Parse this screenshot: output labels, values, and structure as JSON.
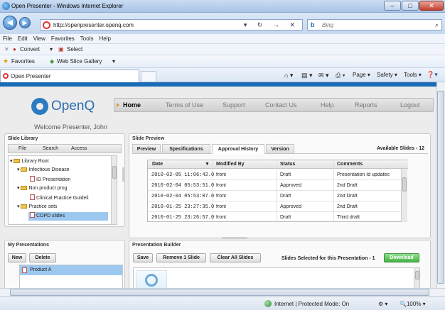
{
  "window": {
    "title": "Open Presenter - Windows Internet Explorer",
    "minimize": "–",
    "maximize": "□",
    "close": "✕"
  },
  "browser": {
    "back": "◀",
    "forward": "▶",
    "url": "http://openpresenter.openq.com",
    "search_placeholder": "Bing",
    "bing_glyph": "b",
    "search_glyph": "⌕",
    "addr_tools": "▾ ↻ → ✕",
    "menu": [
      "File",
      "Edit",
      "View",
      "Favorites",
      "Tools",
      "Help"
    ],
    "convert": "Convert",
    "select": "Select",
    "favorites": "Favorites",
    "web_slice": "Web Slice Gallery",
    "tab_title": "Open Presenter",
    "cmd_page": "Page",
    "cmd_safety": "Safety",
    "cmd_tools": "Tools",
    "status_text": "Internet | Protected Mode: On",
    "zoom": "100%"
  },
  "app": {
    "logo": "OpenQ",
    "nav": [
      "Home",
      "Terms of Use",
      "Support",
      "Contact Us",
      "Help",
      "Reports",
      "Logout"
    ],
    "welcome": "Welcome Presenter, John"
  },
  "library": {
    "title": "Slide Library",
    "tabs": [
      "File",
      "Search",
      "Access"
    ],
    "tree": [
      {
        "label": "Library Root",
        "type": "folder"
      },
      {
        "label": "Infectious Disease",
        "type": "folder"
      },
      {
        "label": "ID Presentation",
        "type": "file"
      },
      {
        "label": "Non product prog",
        "type": "folder"
      },
      {
        "label": "Clinical Practice Guideli",
        "type": "file"
      },
      {
        "label": "Practice sets",
        "type": "folder"
      },
      {
        "label": "COPD slides",
        "type": "file"
      }
    ]
  },
  "preview": {
    "title": "Slide Preview",
    "tabs": [
      "Preview",
      "Specifications",
      "Approval History",
      "Version"
    ],
    "available": "Available Slides - 12",
    "columns": [
      "Date",
      "Modified By",
      "Status",
      "Comments"
    ],
    "sort_glyph": "▼",
    "rows": [
      [
        "2010-02-05 11:06:42.0",
        "front",
        "Draft",
        "Presentation Id updatec"
      ],
      [
        "2010-02-04 05:53:51.0",
        "front",
        "Approved",
        "2nd Draft"
      ],
      [
        "2010-02-04 05:53:07.0",
        "front",
        "Draft",
        "2nd Draft"
      ],
      [
        "2010-01-25 23:27:35.0",
        "front",
        "Approved",
        "2nd Draft"
      ],
      [
        "2010-01-25 23:26:57.0",
        "front",
        "Draft",
        "Third draft"
      ]
    ]
  },
  "my_presentations": {
    "title": "My Presentations",
    "new": "New",
    "delete": "Delete",
    "items": [
      "Product A"
    ]
  },
  "builder": {
    "title": "Presentation Builder",
    "save": "Save",
    "remove": "Remove 1 Slide",
    "clear": "Clear All Slides",
    "selected": "Slides Selected for this Presentation - 1",
    "download": "Download"
  }
}
